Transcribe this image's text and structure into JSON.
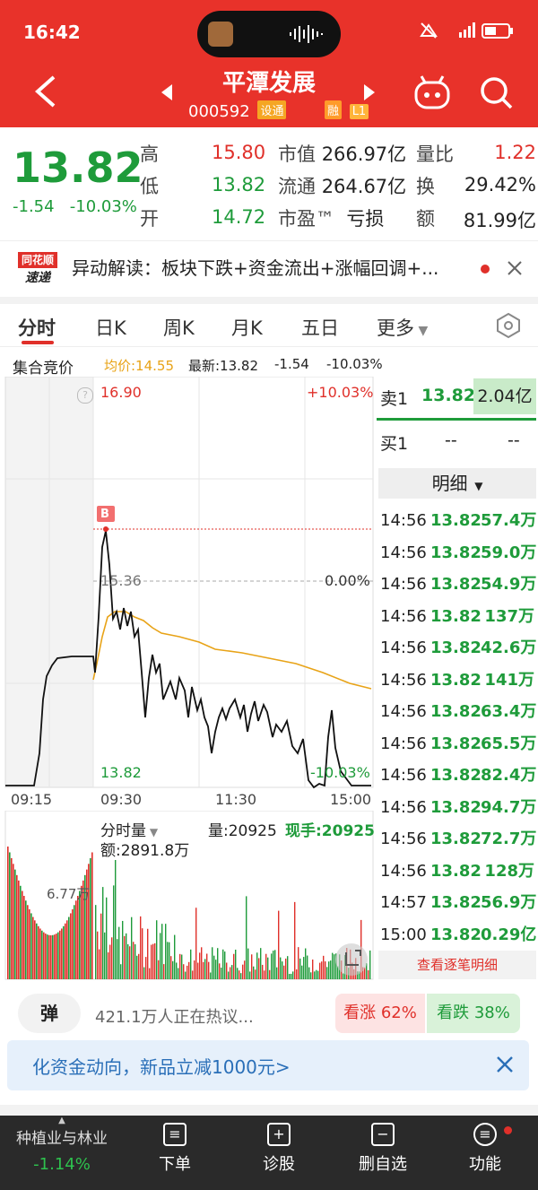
{
  "status_bar": {
    "time": "16:42",
    "icons": "5G"
  },
  "header": {
    "title": "平潭发展",
    "code": "000592",
    "tags": [
      "设通",
      "融",
      "L1"
    ]
  },
  "quote": {
    "price": "13.82",
    "change": "-1.54",
    "change_pct": "-10.03%",
    "fields": [
      {
        "label": "高",
        "value": "15.80"
      },
      {
        "label": "低",
        "value": "13.82"
      },
      {
        "label": "开",
        "value": "14.72"
      },
      {
        "label": "市值",
        "value": "266.97亿"
      },
      {
        "label": "流通",
        "value": "264.67亿"
      },
      {
        "label": "市盈™",
        "value": "亏损"
      },
      {
        "label": "量比",
        "value": "1.22"
      },
      {
        "label": "换",
        "value": "29.42%"
      },
      {
        "label": "额",
        "value": "81.99亿"
      }
    ]
  },
  "news": {
    "logo_top": "同花顺",
    "logo_bottom": "速递",
    "text": "异动解读：板块下跌+资金流出+涨幅回调+..."
  },
  "tabs": [
    "分时",
    "日K",
    "周K",
    "月K",
    "五日",
    "更多"
  ],
  "stat_bar": {
    "label": "集合竞价",
    "avg": "均价:14.55",
    "latest": "最新:13.82",
    "chg": "-1.54",
    "pct": "-10.03%"
  },
  "chart": {
    "top_price": "16.90",
    "top_pct": "+10.03%",
    "mid_price": "15.36",
    "mid_pct": "0.00%",
    "bottom_price": "13.82",
    "bottom_pct": "-10.03%",
    "marker": "B",
    "x_labels": [
      "09:15",
      "09:30",
      "11:30",
      "15:00"
    ],
    "colors": {
      "price": "#111111",
      "avg": "#e8a317",
      "up": "#e0302a",
      "down": "#1e9b3a"
    }
  },
  "volume": {
    "selector": "分时量",
    "vol": "量:20925",
    "now": "现手:20925",
    "amount": "额:2891.8万",
    "scale": "6.77万"
  },
  "book": {
    "sell1": {
      "label": "卖1",
      "price": "13.82",
      "vol": "2.04亿"
    },
    "buy1": {
      "label": "买1",
      "price": "--",
      "vol": "--"
    },
    "detail_label": "明细",
    "trades": [
      {
        "t": "14:56",
        "p": "13.82",
        "v": "57.4万"
      },
      {
        "t": "14:56",
        "p": "13.82",
        "v": "59.0万"
      },
      {
        "t": "14:56",
        "p": "13.82",
        "v": "54.9万"
      },
      {
        "t": "14:56",
        "p": "13.82",
        "v": "137万"
      },
      {
        "t": "14:56",
        "p": "13.82",
        "v": "42.6万"
      },
      {
        "t": "14:56",
        "p": "13.82",
        "v": "141万"
      },
      {
        "t": "14:56",
        "p": "13.82",
        "v": "63.4万"
      },
      {
        "t": "14:56",
        "p": "13.82",
        "v": "65.5万"
      },
      {
        "t": "14:56",
        "p": "13.82",
        "v": "82.4万"
      },
      {
        "t": "14:56",
        "p": "13.82",
        "v": "94.7万"
      },
      {
        "t": "14:56",
        "p": "13.82",
        "v": "72.7万"
      },
      {
        "t": "14:56",
        "p": "13.82",
        "v": "128万"
      },
      {
        "t": "14:57",
        "p": "13.82",
        "v": "56.9万"
      },
      {
        "t": "15:00",
        "p": "13.82",
        "v": "0.29亿"
      }
    ],
    "more": "查看逐笔明细"
  },
  "discussion": {
    "icon": "弹",
    "text": "421.1万人正在热议...",
    "up": "看涨 62%",
    "down": "看跌 38%"
  },
  "promo": {
    "text": "化资金动向，新品立减1000元>"
  },
  "bottom_nav": {
    "sector": "种植业与林业",
    "sector_pct": "-1.14%",
    "items": [
      "下单",
      "诊股",
      "删自选",
      "功能"
    ]
  }
}
